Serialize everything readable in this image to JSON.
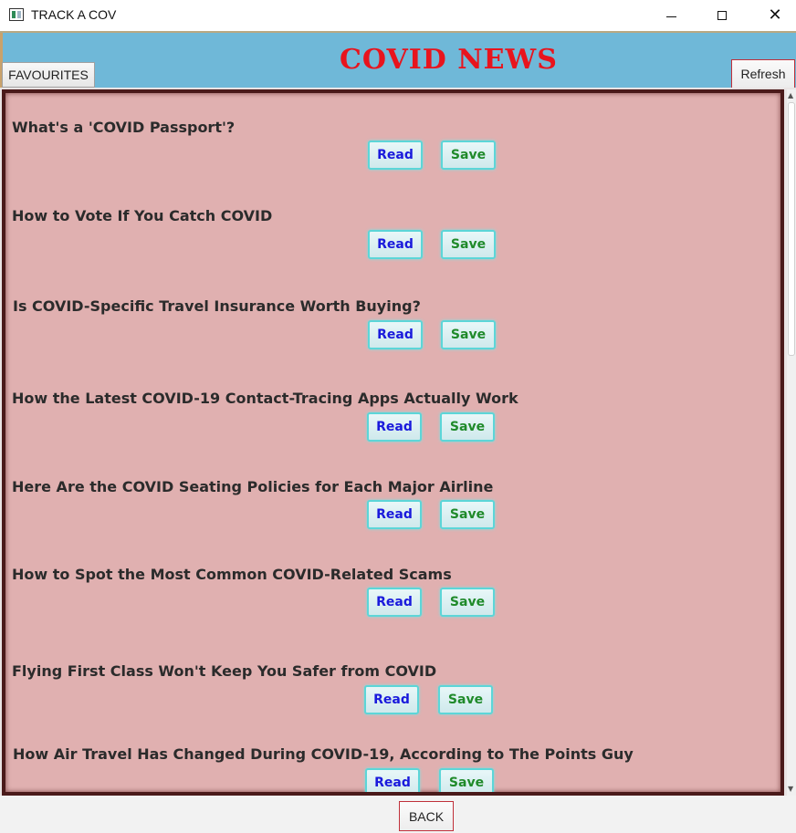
{
  "window": {
    "title": "TRACK A COV"
  },
  "header": {
    "favourites_label": "FAVOURITES",
    "title": "COVID NEWS",
    "refresh_label": "Refresh"
  },
  "articles": [
    {
      "title": "What's a 'COVID Passport'?",
      "read_label": "Read",
      "save_label": "Save"
    },
    {
      "title": "How to Vote If You Catch COVID",
      "read_label": "Read",
      "save_label": "Save"
    },
    {
      "title": "Is COVID-Specific Travel Insurance Worth Buying?",
      "read_label": "Read",
      "save_label": "Save"
    },
    {
      "title": "How the Latest COVID-19 Contact-Tracing Apps Actually Work",
      "read_label": "Read",
      "save_label": "Save"
    },
    {
      "title": "Here Are the COVID Seating Policies for Each Major Airline",
      "read_label": "Read",
      "save_label": "Save"
    },
    {
      "title": "How to Spot the Most Common COVID-Related Scams",
      "read_label": "Read",
      "save_label": "Save"
    },
    {
      "title": "Flying First Class Won't Keep You Safer from COVID",
      "read_label": "Read",
      "save_label": "Save"
    },
    {
      "title": "How Air Travel Has Changed During COVID-19, According to The Points Guy",
      "read_label": "Read",
      "save_label": "Save"
    }
  ],
  "footer": {
    "back_label": "BACK"
  },
  "colors": {
    "header_bg": "#6fb8d8",
    "title_red": "#e8141d",
    "content_bg": "#e0b0b0",
    "read_text": "#1a1adc",
    "save_text": "#1f8a2a"
  }
}
